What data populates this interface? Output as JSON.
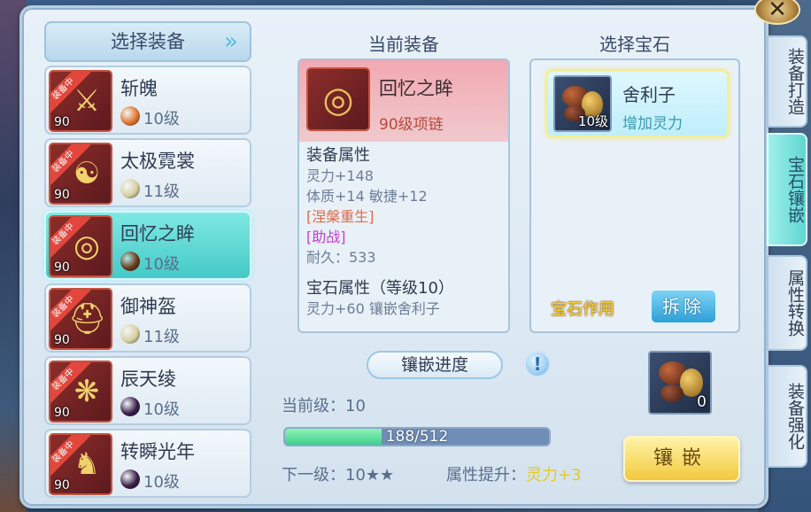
{
  "left": {
    "header": "选择装备",
    "items": [
      {
        "badge": "装备中",
        "level": "90",
        "name": "斩魄",
        "gem_level": "10级",
        "gem_color": "#e0762d",
        "glyph": "⚔"
      },
      {
        "badge": "装备中",
        "level": "90",
        "name": "太极霓裳",
        "gem_level": "11级",
        "gem_color": "#d8d0a0",
        "glyph": "☯"
      },
      {
        "badge": "装备中",
        "level": "90",
        "name": "回忆之眸",
        "gem_level": "10级",
        "gem_color": "#6b3a1c",
        "glyph": "◎"
      },
      {
        "badge": "装备中",
        "level": "90",
        "name": "御神盔",
        "gem_level": "11级",
        "gem_color": "#d8d0a0",
        "glyph": "⛑"
      },
      {
        "badge": "装备中",
        "level": "90",
        "name": "辰天绫",
        "gem_level": "10级",
        "gem_color": "#3a1f4a",
        "glyph": "❋"
      },
      {
        "badge": "装备中",
        "level": "90",
        "name": "转瞬光年",
        "gem_level": "10级",
        "gem_color": "#3a1f4a",
        "glyph": "♞"
      }
    ],
    "selected_index": 2
  },
  "center": {
    "title": "当前装备",
    "equip": {
      "name": "回忆之眸",
      "type": "90级项链",
      "glyph": "◎",
      "attr_header": "装备属性",
      "attrs": [
        "灵力+148",
        "体质+14 敏捷+12"
      ],
      "special1": "[涅槃重生]",
      "special2": "[助战]",
      "durability": "耐久：533",
      "gem_attr_header": "宝石属性（等级10）",
      "gem_attr": "灵力+60 镶嵌舍利子"
    }
  },
  "right": {
    "title": "选择宝石",
    "gem": {
      "name": "舍利子",
      "level": "10级",
      "effect": "增加灵力"
    },
    "effect_label": "宝石作用",
    "remove_button": "拆除"
  },
  "progress": {
    "label": "镶嵌进度",
    "current_level": "当前级：10",
    "bar_text": "188/512",
    "progress_fraction": 0.367,
    "next_level": "下一级：10★★",
    "attr_up_label": "属性提升：",
    "attr_up_value": "灵力+3",
    "material_count": "0",
    "inlay_button": "镶嵌"
  },
  "tabs": [
    "装备打造",
    "宝石镶嵌",
    "属性转换",
    "装备强化"
  ],
  "active_tab": 1,
  "close_label": "✕"
}
